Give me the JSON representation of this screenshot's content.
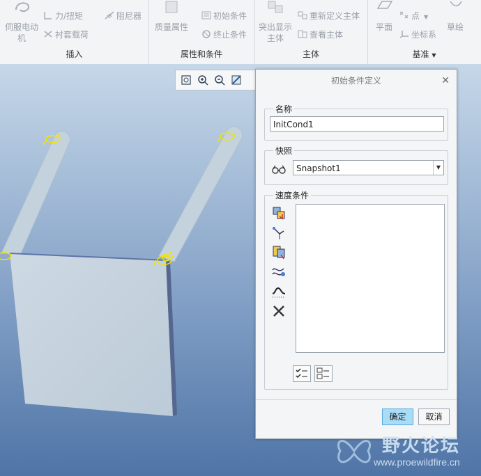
{
  "ribbon": {
    "insert_group": {
      "title": "插入",
      "servo_motor": "伺服电动机",
      "force_torque": "力/扭矩",
      "damper": "阻尼器",
      "bushing_load": "衬套载荷"
    },
    "props_group": {
      "title": "属性和条件",
      "mass_props": "质量属性",
      "initial_cond": "初始条件",
      "termination_cond": "终止条件"
    },
    "body_group": {
      "title": "主体",
      "highlight_bodies": "突出显示主体",
      "redefine_bodies": "重新定义主体",
      "view_bodies": "查看主体"
    },
    "datum_group": {
      "title": "基准",
      "plane": "平面",
      "point": "点",
      "csys": "坐标系",
      "sketch": "草绘"
    }
  },
  "dialog": {
    "title": "初始条件定义",
    "name_section": "名称",
    "name_value": "InitCond1",
    "snapshot_section": "快照",
    "snapshot_value": "Snapshot1",
    "velocity_section": "速度条件",
    "ok_label": "确定",
    "cancel_label": "取消"
  },
  "watermark": {
    "title": "野火论坛",
    "url": "www.proewildfire.cn"
  },
  "colors": {
    "dialog_bg": "#f4f5f7",
    "ok_button": "#a9dcf7",
    "viewport_top": "#c6d7e8",
    "viewport_bottom": "#4f74a6",
    "model": "#c7d5e0",
    "motor_symbol": "#f2e300"
  }
}
